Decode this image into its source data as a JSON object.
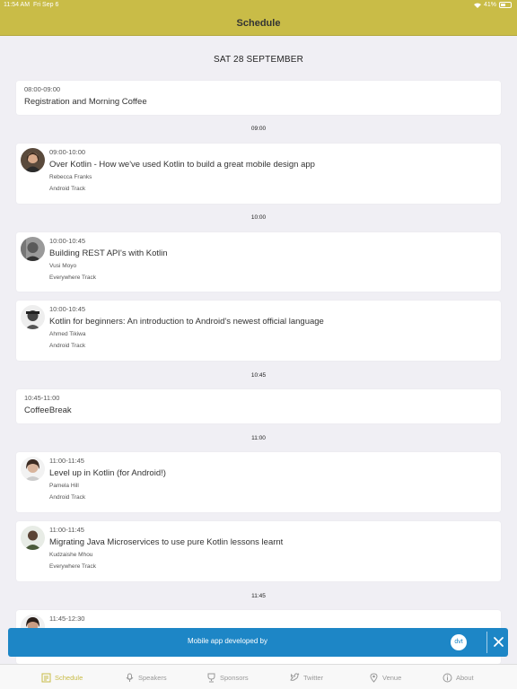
{
  "status": {
    "time": "11:54 AM",
    "date": "Fri Sep 6",
    "battery": "41%"
  },
  "header": {
    "title": "Schedule"
  },
  "date_heading": "SAT 28 SEPTEMBER",
  "cards": [
    {
      "time": "08:00-09:00",
      "title": "Registration and Morning Coffee"
    },
    {
      "time": "09:00-10:00",
      "title": "Over Kotlin - How we've used Kotlin to build a great mobile design app",
      "speaker": "Rebecca Franks",
      "track": "Android Track"
    },
    {
      "time": "10:00-10:45",
      "title": "Building REST API's with Kotlin",
      "speaker": "Vusi Moyo",
      "track": "Everywhere Track"
    },
    {
      "time": "10:00-10:45",
      "title": "Kotlin for beginners: An introduction to Android's newest official language",
      "speaker": "Ahmed Tikiwa",
      "track": "Android Track"
    },
    {
      "time": "10:45-11:00",
      "title": "CoffeeBreak"
    },
    {
      "time": "11:00-11:45",
      "title": "Level up in Kotlin (for Android!)",
      "speaker": "Pamela Hill",
      "track": "Android Track"
    },
    {
      "time": "11:00-11:45",
      "title": "Migrating Java Microservices to use pure Kotlin lessons learnt",
      "speaker": "Kudzaishe Mhou",
      "track": "Everywhere Track"
    },
    {
      "time": "11:45-12:30"
    }
  ],
  "time_separators": [
    "09:00",
    "10:00",
    "10:45",
    "11:00",
    "11:45"
  ],
  "banner": {
    "text": "Mobile app developed by",
    "logo": "dvt"
  },
  "tabs": [
    {
      "label": "Schedule",
      "icon": "schedule-icon"
    },
    {
      "label": "Speakers",
      "icon": "speakers-icon"
    },
    {
      "label": "Sponsors",
      "icon": "sponsors-icon"
    },
    {
      "label": "Twitter",
      "icon": "twitter-icon"
    },
    {
      "label": "Venue",
      "icon": "venue-icon"
    },
    {
      "label": "About",
      "icon": "about-icon"
    }
  ],
  "colors": {
    "accent": "#c9bc47",
    "banner": "#1d86c6",
    "background": "#f0eff4"
  }
}
